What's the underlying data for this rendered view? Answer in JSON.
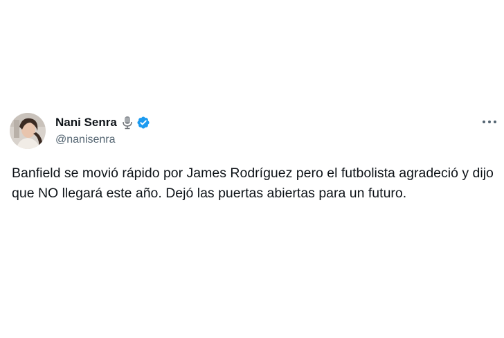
{
  "author": {
    "display_name": "Nani Senra",
    "handle": "@nanisenra",
    "badges": [
      "microphone-icon",
      "verified-badge-icon"
    ],
    "verified_color": "#1d9bf0"
  },
  "tweet": {
    "text": "Banfield se movió rápido por James Rodríguez pero el futbolista agradeció y dijo que NO llegará este año. Dejó las puertas abiertas para un futuro."
  },
  "menu": {
    "icon": "more-options-icon"
  },
  "colors": {
    "text_primary": "#0f1419",
    "text_secondary": "#536471",
    "background": "#ffffff"
  }
}
